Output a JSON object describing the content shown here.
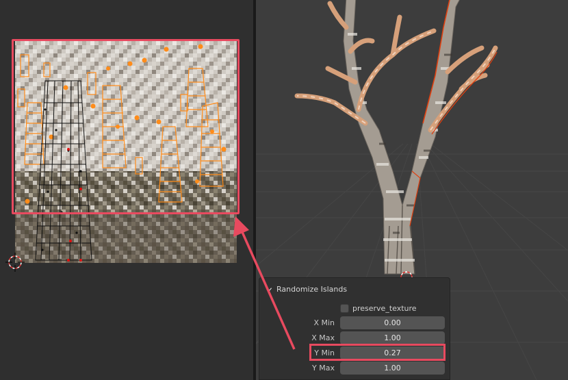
{
  "operator_panel": {
    "title": "Randomize Islands",
    "preserve_texture_label": "preserve_texture",
    "preserve_texture_checked": false,
    "x_min_label": "X Min",
    "x_min_value": "0.00",
    "x_max_label": "X Max",
    "x_max_value": "1.00",
    "y_min_label": "Y Min",
    "y_min_value": "0.27",
    "y_max_label": "Y Max",
    "y_max_value": "1.00"
  },
  "colors": {
    "highlight": "#e84a5f",
    "uv_selected": "#ff8c1a",
    "viewport_bg": "#3d3d3d",
    "editor_bg": "#2f2f2f"
  },
  "icons": {
    "cursor": "3d-cursor-icon",
    "collapse": "chevron-down-icon"
  }
}
